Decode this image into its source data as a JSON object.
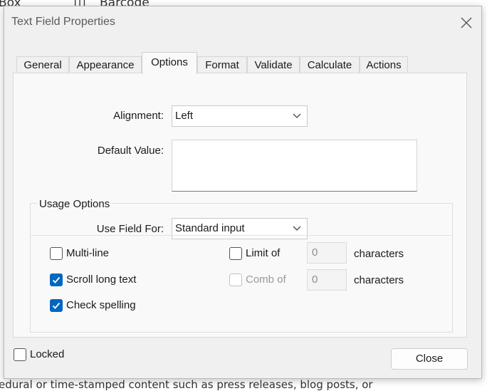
{
  "background": {
    "top_text_box": "Box",
    "top_text_barcode": "Barcode",
    "bottom_text": "edural or time-stamped content such as press releases, blog posts, or"
  },
  "dialog": {
    "title": "Text Field Properties",
    "close_icon": "close-icon"
  },
  "tabs": [
    {
      "label": "General",
      "active": false
    },
    {
      "label": "Appearance",
      "active": false
    },
    {
      "label": "Options",
      "active": true
    },
    {
      "label": "Format",
      "active": false
    },
    {
      "label": "Validate",
      "active": false
    },
    {
      "label": "Calculate",
      "active": false
    },
    {
      "label": "Actions",
      "active": false
    }
  ],
  "options": {
    "alignment_label": "Alignment:",
    "alignment_value": "Left",
    "default_value_label": "Default Value:",
    "default_value": "",
    "usage_title": "Usage Options",
    "use_field_for_label": "Use Field For:",
    "use_field_for_value": "Standard input",
    "multiline": {
      "label": "Multi-line",
      "checked": false
    },
    "scroll": {
      "label": "Scroll long text",
      "checked": true
    },
    "spell": {
      "label": "Check spelling",
      "checked": true
    },
    "limit": {
      "label": "Limit of",
      "checked": false,
      "value": "0",
      "suffix": "characters"
    },
    "comb": {
      "label": "Comb of",
      "checked": false,
      "disabled": true,
      "value": "0",
      "suffix": "characters"
    }
  },
  "footer": {
    "locked_label": "Locked",
    "locked_checked": false,
    "close_label": "Close"
  },
  "colors": {
    "accent": "#0067c0",
    "dialog_bg": "#f0f0f0"
  }
}
